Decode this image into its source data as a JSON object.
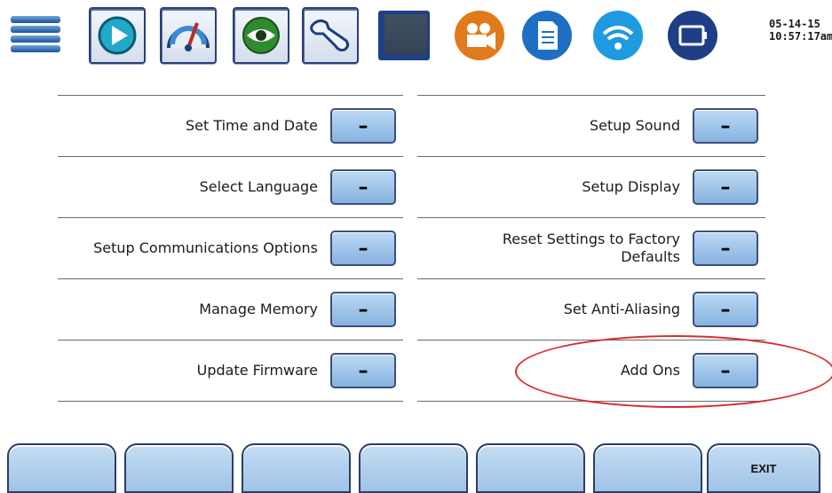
{
  "toolbar": {
    "icons": [
      {
        "name": "menu-stack-icon"
      },
      {
        "name": "play-icon"
      },
      {
        "name": "gauge-icon"
      },
      {
        "name": "eye-icon"
      },
      {
        "name": "wrench-icon"
      },
      {
        "name": "screen-icon"
      },
      {
        "name": "video-camera-icon"
      },
      {
        "name": "document-icon"
      },
      {
        "name": "wifi-icon"
      },
      {
        "name": "battery-icon"
      }
    ],
    "date": "05-14-15",
    "time": "10:57:17am"
  },
  "settings": {
    "left": [
      {
        "label": "Set Time and Date",
        "button": "–"
      },
      {
        "label": "Select Language",
        "button": "–"
      },
      {
        "label": "Setup Communications Options",
        "button": "–"
      },
      {
        "label": "Manage Memory",
        "button": "–"
      },
      {
        "label": "Update Firmware",
        "button": "–"
      }
    ],
    "right": [
      {
        "label": "Setup Sound",
        "button": "–"
      },
      {
        "label": "Setup Display",
        "button": "–"
      },
      {
        "label": "Reset Settings to Factory Defaults",
        "button": "–"
      },
      {
        "label": "Set Anti-Aliasing",
        "button": "–"
      },
      {
        "label": "Add Ons",
        "button": "–"
      }
    ]
  },
  "softkeys": [
    "",
    "",
    "",
    "",
    "",
    "",
    "EXIT"
  ],
  "colors": {
    "highlight": "#d92d2d",
    "button_fill": "#9ec4e8",
    "icon_blue": "#1e6fc4",
    "icon_orange": "#e07a1a",
    "icon_green": "#2e8b2e"
  }
}
